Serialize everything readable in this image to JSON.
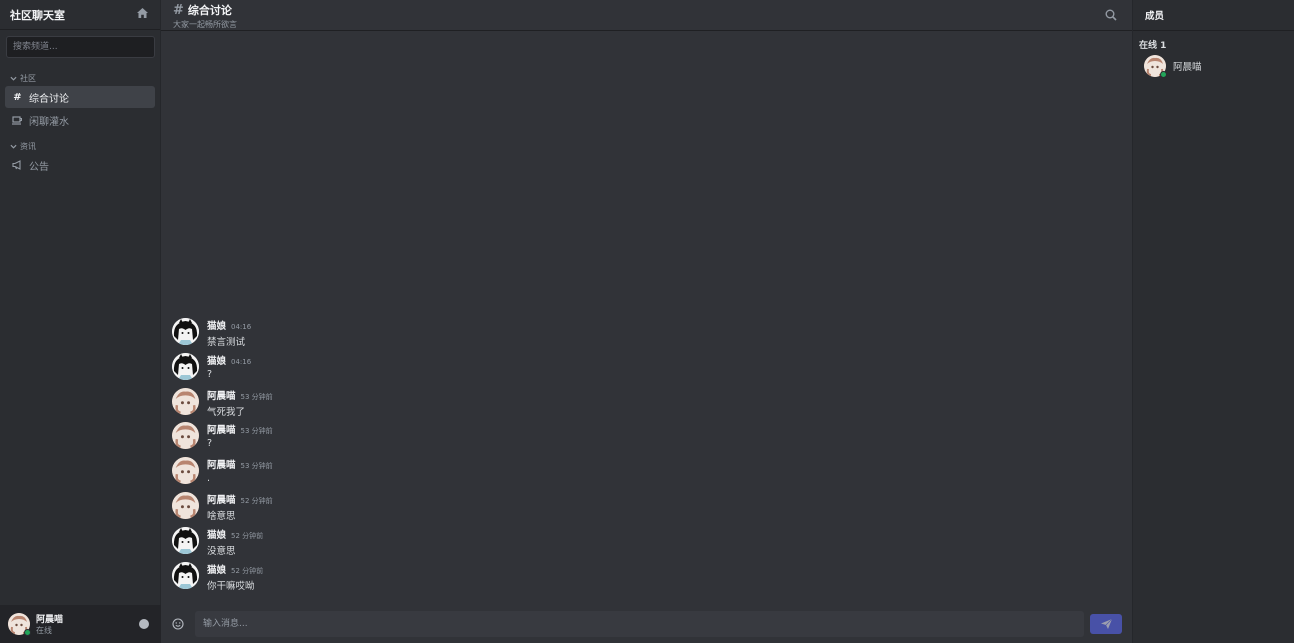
{
  "sidebar": {
    "title": "社区聊天室",
    "search_placeholder": "搜索频道...",
    "categories": [
      {
        "name": "社区",
        "channels": [
          {
            "label": "综合讨论",
            "icon": "hash-icon",
            "active": true
          },
          {
            "label": "闲聊灌水",
            "icon": "coffee-icon",
            "active": false
          }
        ]
      },
      {
        "name": "资讯",
        "channels": [
          {
            "label": "公告",
            "icon": "megaphone-icon",
            "active": false
          }
        ]
      }
    ]
  },
  "user_panel": {
    "name": "阿晨喵",
    "status": "在线"
  },
  "channel": {
    "name": "综合讨论",
    "topic": "大家一起畅所欲言"
  },
  "messages": [
    {
      "author": "猫娘",
      "time": "04:16",
      "text": "禁言测试"
    },
    {
      "author": "猫娘",
      "time": "04:16",
      "text": "?"
    },
    {
      "author": "阿晨喵",
      "time": "53 分钟前",
      "text": "气死我了"
    },
    {
      "author": "阿晨喵",
      "time": "53 分钟前",
      "text": "?"
    },
    {
      "author": "阿晨喵",
      "time": "53 分钟前",
      "text": "."
    },
    {
      "author": "阿晨喵",
      "time": "52 分钟前",
      "text": "啥意思"
    },
    {
      "author": "猫娘",
      "time": "52 分钟前",
      "text": "没意思"
    },
    {
      "author": "猫娘",
      "time": "52 分钟前",
      "text": "你干嘛哎呦"
    }
  ],
  "composer": {
    "placeholder": "输入消息..."
  },
  "members": {
    "title": "成员",
    "online_label": "在线 1",
    "list": [
      {
        "name": "阿晨喵",
        "status": "online"
      }
    ]
  },
  "colors": {
    "accent": "#5865f2",
    "online": "#23a55a",
    "background": "#313338",
    "sidebar": "#2b2d31"
  }
}
